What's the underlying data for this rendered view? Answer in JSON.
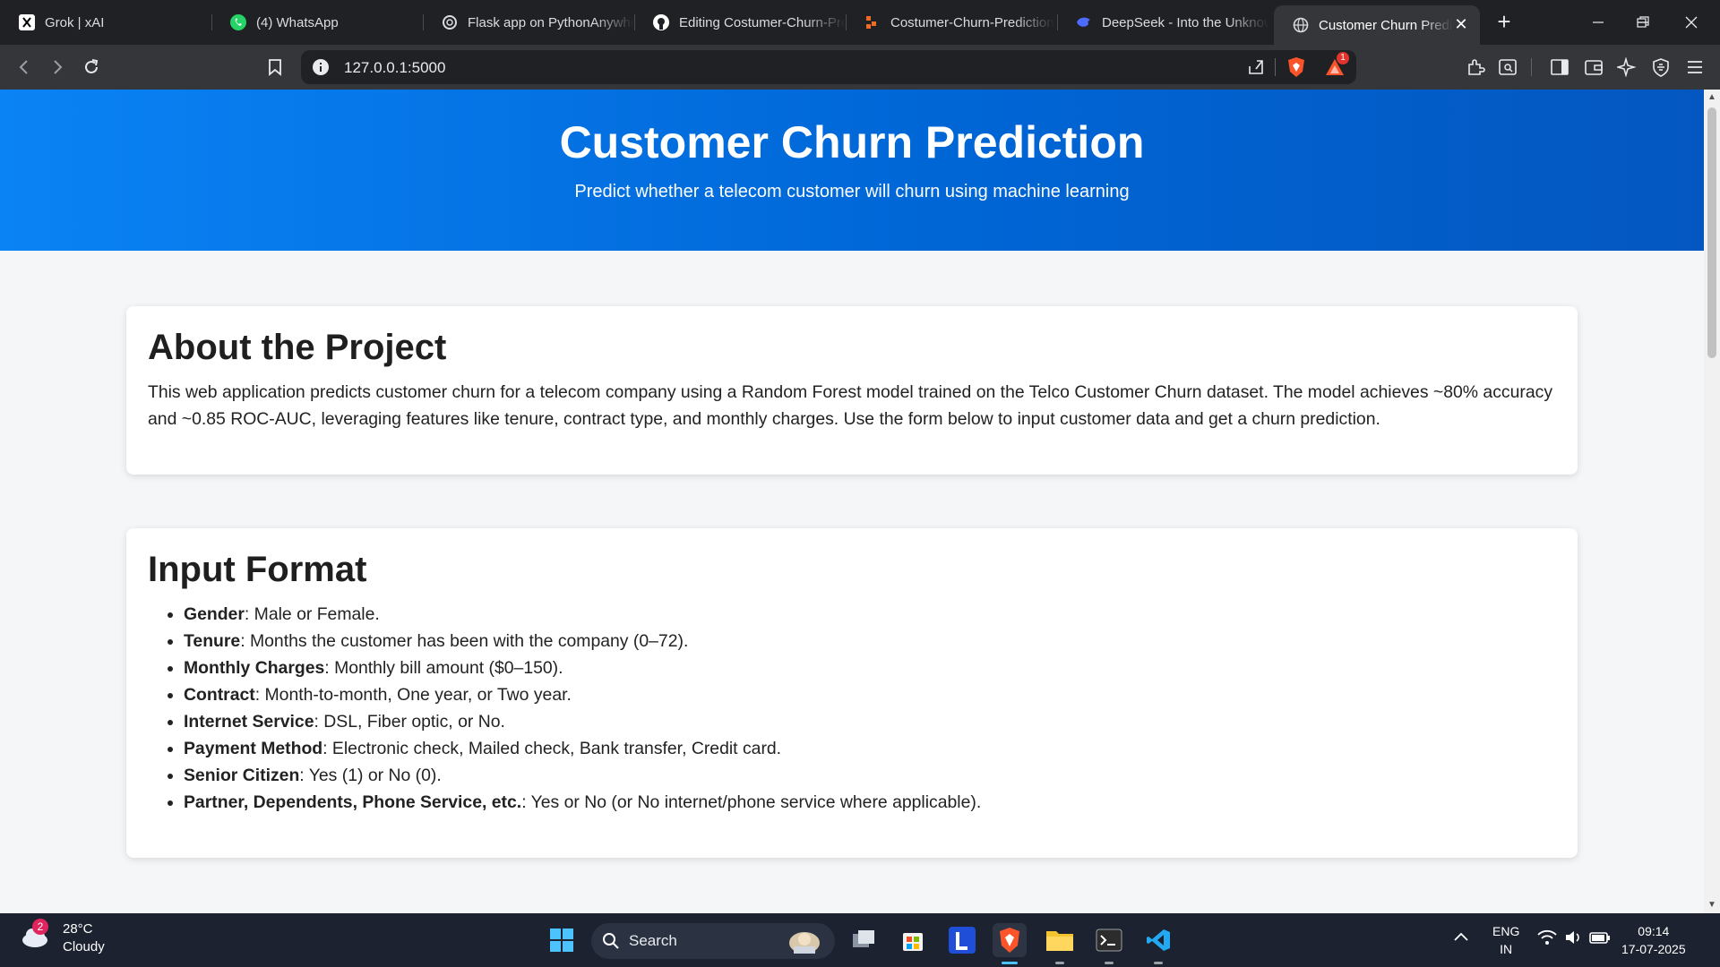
{
  "browser": {
    "tabs": [
      {
        "title": "Grok | xAI",
        "icon": "grok-icon"
      },
      {
        "title": "(4) WhatsApp",
        "icon": "whatsapp-icon"
      },
      {
        "title": "Flask app on PythonAnywhere",
        "icon": "openai-icon"
      },
      {
        "title": "Editing Costumer-Churn-Prediction",
        "icon": "github-icon"
      },
      {
        "title": "Costumer-Churn-Prediction",
        "icon": "render-icon"
      },
      {
        "title": "DeepSeek - Into the Unknown",
        "icon": "deepseek-icon"
      },
      {
        "title": "Customer Churn Prediction",
        "icon": "globe-icon",
        "active": true
      }
    ],
    "address": "127.0.0.1:5000",
    "notification_count": "1"
  },
  "hero": {
    "title": "Customer Churn Prediction",
    "subtitle": "Predict whether a telecom customer will churn using machine learning"
  },
  "about": {
    "heading": "About the Project",
    "body": "This web application predicts customer churn for a telecom company using a Random Forest model trained on the Telco Customer Churn dataset. The model achieves ~80% accuracy and ~0.85 ROC-AUC, leveraging features like tenure, contract type, and monthly charges. Use the form below to input customer data and get a churn prediction."
  },
  "input_format": {
    "heading": "Input Format",
    "items": [
      {
        "label": "Gender",
        "text": ": Male or Female."
      },
      {
        "label": "Tenure",
        "text": ": Months the customer has been with the company (0–72)."
      },
      {
        "label": "Monthly Charges",
        "text": ": Monthly bill amount ($0–150)."
      },
      {
        "label": "Contract",
        "text": ": Month-to-month, One year, or Two year."
      },
      {
        "label": "Internet Service",
        "text": ": DSL, Fiber optic, or No."
      },
      {
        "label": "Payment Method",
        "text": ": Electronic check, Mailed check, Bank transfer, Credit card."
      },
      {
        "label": "Senior Citizen",
        "text": ": Yes (1) or No (0)."
      },
      {
        "label": "Partner, Dependents, Phone Service, etc.",
        "text": ": Yes or No (or No internet/phone service where applicable)."
      }
    ]
  },
  "taskbar": {
    "weather_badge": "2",
    "temperature": "28°C",
    "condition": "Cloudy",
    "search_label": "Search",
    "language": "ENG",
    "region": "IN",
    "time": "09:14",
    "date": "17-07-2025"
  },
  "colors": {
    "hero_start": "#0a83f5",
    "hero_end": "#0457c0",
    "page_bg": "#f4f6f8",
    "taskbar_bg": "#1c2230"
  }
}
